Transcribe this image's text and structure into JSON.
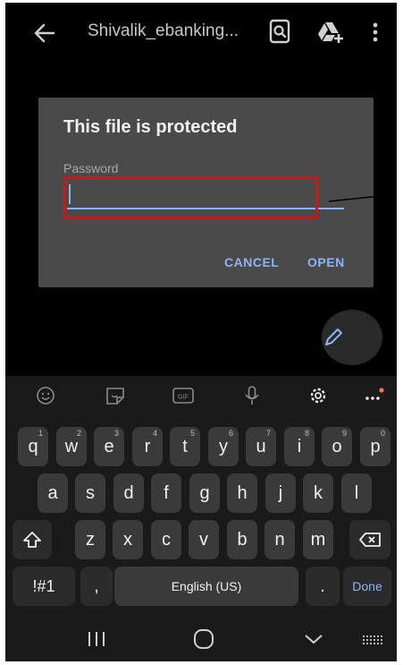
{
  "toolbar": {
    "title": "Shivalik_ebanking...",
    "back_icon": "arrow-left-icon",
    "find_icon": "find-in-document-icon",
    "drive_icon": "add-to-drive-icon",
    "more_icon": "more-vertical-icon"
  },
  "dialog": {
    "title": "This file is protected",
    "password_label": "Password",
    "password_value": "",
    "cancel_label": "CANCEL",
    "open_label": "OPEN"
  },
  "fab": {
    "icon": "pencil-icon"
  },
  "keyboard": {
    "toolbar_icons": [
      "emoji-icon",
      "sticker-icon",
      "gif-icon",
      "microphone-icon",
      "settings-icon",
      "more-horizontal-icon"
    ],
    "rows": [
      [
        {
          "label": "q",
          "hint": "1"
        },
        {
          "label": "w",
          "hint": "2"
        },
        {
          "label": "e",
          "hint": "3"
        },
        {
          "label": "r",
          "hint": "4"
        },
        {
          "label": "t",
          "hint": "5"
        },
        {
          "label": "y",
          "hint": "6"
        },
        {
          "label": "u",
          "hint": "7"
        },
        {
          "label": "i",
          "hint": "8"
        },
        {
          "label": "o",
          "hint": "9"
        },
        {
          "label": "p",
          "hint": "0"
        }
      ],
      [
        {
          "label": "a"
        },
        {
          "label": "s"
        },
        {
          "label": "d"
        },
        {
          "label": "f"
        },
        {
          "label": "g"
        },
        {
          "label": "h"
        },
        {
          "label": "j"
        },
        {
          "label": "k"
        },
        {
          "label": "l"
        }
      ],
      [
        {
          "label": "z"
        },
        {
          "label": "x"
        },
        {
          "label": "c"
        },
        {
          "label": "v"
        },
        {
          "label": "b"
        },
        {
          "label": "n"
        },
        {
          "label": "m"
        }
      ]
    ],
    "symbols_label": "!#1",
    "comma_label": ",",
    "space_label": "English (US)",
    "period_label": ".",
    "done_label": "Done"
  },
  "colors": {
    "accent": "#8ab4f8",
    "highlight": "#c41a1a",
    "dialog_bg": "#4a4a4a",
    "key_bg": "#3a3a3a"
  }
}
